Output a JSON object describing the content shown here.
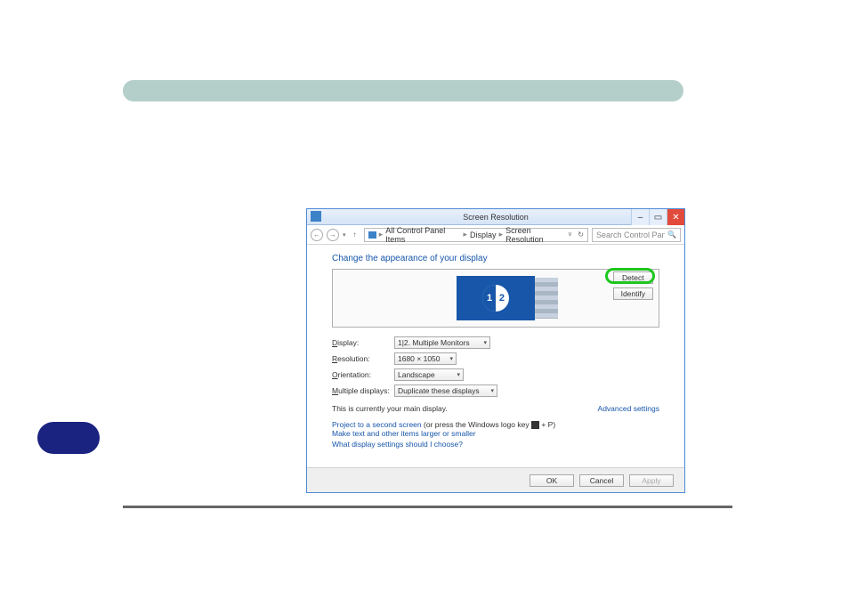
{
  "titlebar": {
    "title": "Screen Resolution"
  },
  "nav": {
    "crumb1": "All Control Panel Items",
    "crumb2": "Display",
    "crumb3": "Screen Resolution",
    "search_placeholder": "Search Control Panel"
  },
  "heading": "Change the appearance of your display",
  "buttons": {
    "detect": "Detect",
    "identify": "Identify",
    "ok": "OK",
    "cancel": "Cancel",
    "apply": "Apply"
  },
  "labels": {
    "display": "Display:",
    "resolution": "Resolution:",
    "orientation": "Orientation:",
    "multiple": "Multiple displays:"
  },
  "values": {
    "display": "1|2. Multiple Monitors",
    "resolution": "1680 × 1050",
    "orientation": "Landscape",
    "multiple": "Duplicate these displays"
  },
  "main_display_text": "This is currently your main display.",
  "advanced_link": "Advanced settings",
  "links": {
    "project": "Project to a second screen",
    "project_hint": "(or press the Windows logo key",
    "project_hint_tail": " + P)",
    "text_size": "Make text and other items larger or smaller",
    "help": "What display settings should I choose?"
  }
}
